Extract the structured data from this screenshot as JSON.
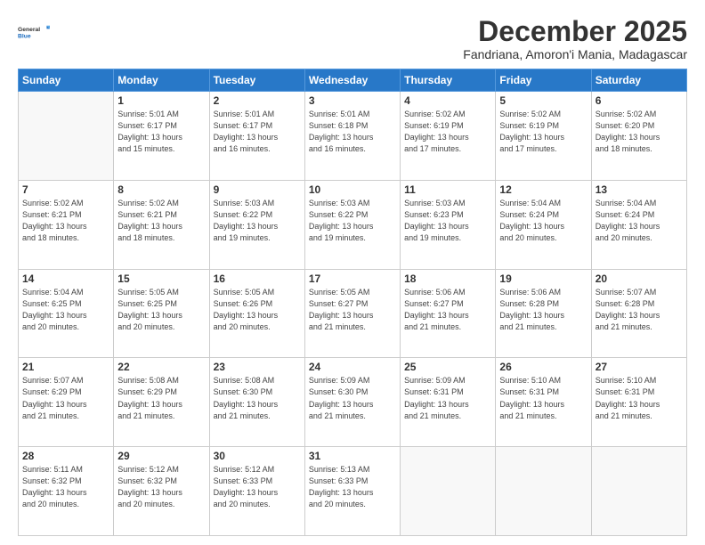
{
  "logo": {
    "general": "General",
    "blue": "Blue"
  },
  "title": "December 2025",
  "subtitle": "Fandriana, Amoron'i Mania, Madagascar",
  "days_header": [
    "Sunday",
    "Monday",
    "Tuesday",
    "Wednesday",
    "Thursday",
    "Friday",
    "Saturday"
  ],
  "weeks": [
    [
      {
        "day": "",
        "info": ""
      },
      {
        "day": "1",
        "info": "Sunrise: 5:01 AM\nSunset: 6:17 PM\nDaylight: 13 hours\nand 15 minutes."
      },
      {
        "day": "2",
        "info": "Sunrise: 5:01 AM\nSunset: 6:17 PM\nDaylight: 13 hours\nand 16 minutes."
      },
      {
        "day": "3",
        "info": "Sunrise: 5:01 AM\nSunset: 6:18 PM\nDaylight: 13 hours\nand 16 minutes."
      },
      {
        "day": "4",
        "info": "Sunrise: 5:02 AM\nSunset: 6:19 PM\nDaylight: 13 hours\nand 17 minutes."
      },
      {
        "day": "5",
        "info": "Sunrise: 5:02 AM\nSunset: 6:19 PM\nDaylight: 13 hours\nand 17 minutes."
      },
      {
        "day": "6",
        "info": "Sunrise: 5:02 AM\nSunset: 6:20 PM\nDaylight: 13 hours\nand 18 minutes."
      }
    ],
    [
      {
        "day": "7",
        "info": "Sunrise: 5:02 AM\nSunset: 6:21 PM\nDaylight: 13 hours\nand 18 minutes."
      },
      {
        "day": "8",
        "info": "Sunrise: 5:02 AM\nSunset: 6:21 PM\nDaylight: 13 hours\nand 18 minutes."
      },
      {
        "day": "9",
        "info": "Sunrise: 5:03 AM\nSunset: 6:22 PM\nDaylight: 13 hours\nand 19 minutes."
      },
      {
        "day": "10",
        "info": "Sunrise: 5:03 AM\nSunset: 6:22 PM\nDaylight: 13 hours\nand 19 minutes."
      },
      {
        "day": "11",
        "info": "Sunrise: 5:03 AM\nSunset: 6:23 PM\nDaylight: 13 hours\nand 19 minutes."
      },
      {
        "day": "12",
        "info": "Sunrise: 5:04 AM\nSunset: 6:24 PM\nDaylight: 13 hours\nand 20 minutes."
      },
      {
        "day": "13",
        "info": "Sunrise: 5:04 AM\nSunset: 6:24 PM\nDaylight: 13 hours\nand 20 minutes."
      }
    ],
    [
      {
        "day": "14",
        "info": "Sunrise: 5:04 AM\nSunset: 6:25 PM\nDaylight: 13 hours\nand 20 minutes."
      },
      {
        "day": "15",
        "info": "Sunrise: 5:05 AM\nSunset: 6:25 PM\nDaylight: 13 hours\nand 20 minutes."
      },
      {
        "day": "16",
        "info": "Sunrise: 5:05 AM\nSunset: 6:26 PM\nDaylight: 13 hours\nand 20 minutes."
      },
      {
        "day": "17",
        "info": "Sunrise: 5:05 AM\nSunset: 6:27 PM\nDaylight: 13 hours\nand 21 minutes."
      },
      {
        "day": "18",
        "info": "Sunrise: 5:06 AM\nSunset: 6:27 PM\nDaylight: 13 hours\nand 21 minutes."
      },
      {
        "day": "19",
        "info": "Sunrise: 5:06 AM\nSunset: 6:28 PM\nDaylight: 13 hours\nand 21 minutes."
      },
      {
        "day": "20",
        "info": "Sunrise: 5:07 AM\nSunset: 6:28 PM\nDaylight: 13 hours\nand 21 minutes."
      }
    ],
    [
      {
        "day": "21",
        "info": "Sunrise: 5:07 AM\nSunset: 6:29 PM\nDaylight: 13 hours\nand 21 minutes."
      },
      {
        "day": "22",
        "info": "Sunrise: 5:08 AM\nSunset: 6:29 PM\nDaylight: 13 hours\nand 21 minutes."
      },
      {
        "day": "23",
        "info": "Sunrise: 5:08 AM\nSunset: 6:30 PM\nDaylight: 13 hours\nand 21 minutes."
      },
      {
        "day": "24",
        "info": "Sunrise: 5:09 AM\nSunset: 6:30 PM\nDaylight: 13 hours\nand 21 minutes."
      },
      {
        "day": "25",
        "info": "Sunrise: 5:09 AM\nSunset: 6:31 PM\nDaylight: 13 hours\nand 21 minutes."
      },
      {
        "day": "26",
        "info": "Sunrise: 5:10 AM\nSunset: 6:31 PM\nDaylight: 13 hours\nand 21 minutes."
      },
      {
        "day": "27",
        "info": "Sunrise: 5:10 AM\nSunset: 6:31 PM\nDaylight: 13 hours\nand 21 minutes."
      }
    ],
    [
      {
        "day": "28",
        "info": "Sunrise: 5:11 AM\nSunset: 6:32 PM\nDaylight: 13 hours\nand 20 minutes."
      },
      {
        "day": "29",
        "info": "Sunrise: 5:12 AM\nSunset: 6:32 PM\nDaylight: 13 hours\nand 20 minutes."
      },
      {
        "day": "30",
        "info": "Sunrise: 5:12 AM\nSunset: 6:33 PM\nDaylight: 13 hours\nand 20 minutes."
      },
      {
        "day": "31",
        "info": "Sunrise: 5:13 AM\nSunset: 6:33 PM\nDaylight: 13 hours\nand 20 minutes."
      },
      {
        "day": "",
        "info": ""
      },
      {
        "day": "",
        "info": ""
      },
      {
        "day": "",
        "info": ""
      }
    ]
  ]
}
